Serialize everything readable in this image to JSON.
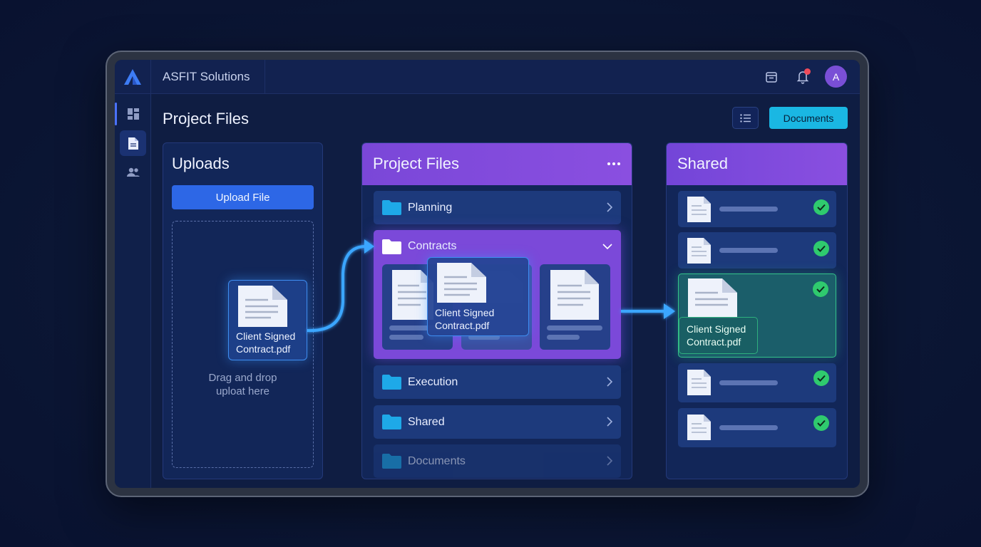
{
  "app": {
    "brand": "ASFIT Solutions",
    "avatar_initial": "A"
  },
  "header": {
    "title": "Project Files",
    "documents_button": "Documents"
  },
  "uploads": {
    "title": "Uploads",
    "upload_button": "Upload File",
    "drop_text_line1": "Drag and drop",
    "drop_text_line2": "uploat here",
    "dragged_file_line1": "Client Signed",
    "dragged_file_line2": "Contract.pdf"
  },
  "projects": {
    "title": "Project Files",
    "folders": [
      {
        "label": "Planning"
      },
      {
        "label": "Contracts"
      },
      {
        "label": "Execution"
      },
      {
        "label": "Shared"
      },
      {
        "label": "Documents"
      }
    ],
    "contracts_drag_file_line1": "Client Signed",
    "contracts_drag_file_line2": "Contract.pdf"
  },
  "shared": {
    "title": "Shared",
    "highlight_file_line1": "Client Signed",
    "highlight_file_line2": "Contract.pdf"
  },
  "colors": {
    "accent_blue": "#2d67e6",
    "accent_cyan": "#1ab7e3",
    "accent_purple": "#7b49d9",
    "success_green": "#2fca6e"
  }
}
